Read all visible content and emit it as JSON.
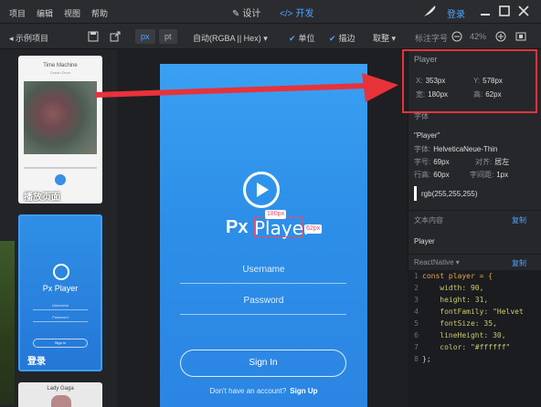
{
  "menubar": {
    "menus": [
      "项目",
      "编辑",
      "视图",
      "帮助"
    ],
    "modes": [
      {
        "label": "设计",
        "icon": "pen-icon",
        "active": false
      },
      {
        "label": "开发",
        "icon": "code-icon",
        "active": true
      }
    ],
    "login": "登录",
    "accent": "#4da3ff"
  },
  "toolbar": {
    "back_label": "示例项目",
    "unit_px": "px",
    "unit_pt": "pt",
    "color_mode": "自动(RGBA || Hex)",
    "unit_toggle": "单位",
    "stroke_toggle": "描边",
    "pick": "取整",
    "zoom_label": "标注字号",
    "zoom_value": "42%"
  },
  "thumbnails": [
    {
      "title": "Time Machine",
      "subtitle": "Ocean Deon",
      "label": "播放页面"
    },
    {
      "logo": "Px Player",
      "username": "Username",
      "password": "Password",
      "signin": "Sign in",
      "label": "登录"
    },
    {
      "title": "Lady Gaga"
    }
  ],
  "phone": {
    "logo_px": "Px",
    "logo_player": "Player",
    "width_badge": "180px",
    "height_badge": "62px",
    "username_placeholder": "Username",
    "password_placeholder": "Password",
    "signin_label": "Sign In",
    "footer_text": "Don't have an account?",
    "footer_link": "Sign Up"
  },
  "inspector": {
    "layer_name": "Player",
    "x_label": "X:",
    "x_value": "353px",
    "y_label": "Y:",
    "y_value": "578px",
    "w_label": "宽:",
    "w_value": "180px",
    "h_label": "高:",
    "h_value": "62px",
    "font_section": "字体",
    "font_name": "\"Player\"",
    "font_family_label": "字体:",
    "font_family_value": "HelveticaNeue-Thin",
    "font_size_label": "字号:",
    "font_size_value": "69px",
    "align_label": "对齐:",
    "align_value": "居左",
    "line_height_label": "行高:",
    "line_height_value": "60px",
    "letter_spacing_label": "字间距:",
    "letter_spacing_value": "1px",
    "color_value": "rgb(255,255,255)",
    "text_section": "文本内容",
    "copy1": "复制",
    "text_value": "Player",
    "react_section": "ReactNative",
    "copy2": "复制",
    "code_lines": [
      "const player = {",
      "    width: 90,",
      "    height: 31,",
      "    fontFamily: \"Helvet",
      "    fontSize: 35,",
      "    lineHeight: 30,",
      "    color: \"#ffffff\"",
      "};"
    ],
    "code_line_numbers": [
      "1",
      "2",
      "3",
      "4",
      "5",
      "6",
      "7",
      "8"
    ]
  },
  "colors": {
    "highlight": "#e8323a",
    "phone_blue": "#2d8fe8"
  }
}
